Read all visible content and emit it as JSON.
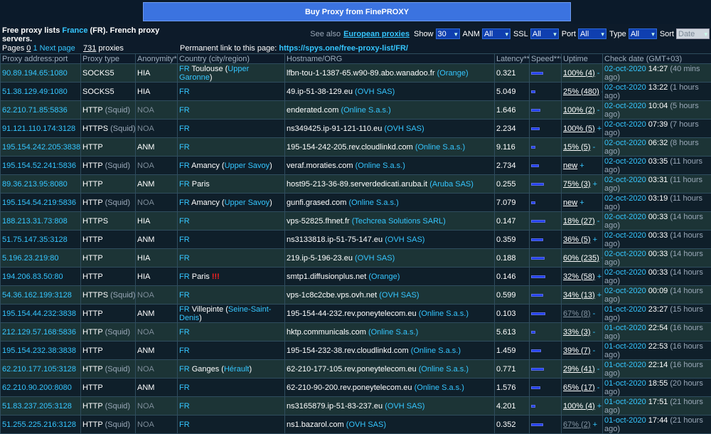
{
  "banner": {
    "label": "Buy Proxy from FinePROXY"
  },
  "header": {
    "free_prefix": "Free proxy lists ",
    "free_country": "France",
    "free_suffix": " (FR). French proxy servers.",
    "see_also": "See also",
    "european_link": "European proxies",
    "show_label": "Show",
    "show_value": "30",
    "anm_label": "ANM",
    "anm_value": "All",
    "ssl_label": "SSL",
    "ssl_value": "All",
    "port_label": "Port",
    "port_value": "All",
    "type_label": "Type",
    "type_value": "All",
    "sort_label": "Sort",
    "sort_value": "Date"
  },
  "pager": {
    "pages_label": "Pages",
    "page_current": "0",
    "page_1": "1",
    "next_label": "Next page",
    "count": "731",
    "count_suffix": " proxies",
    "perm_label": "Permanent link to this page: ",
    "perm_url": "https://spys.one/free-proxy-list/FR/"
  },
  "columns": [
    "Proxy address:port",
    "Proxy type",
    "Anonymity*",
    "Country (city/region)",
    "Hostname/ORG",
    "Latency**",
    "Speed***",
    "Uptime",
    "Check date (GMT+03)"
  ],
  "rows": [
    {
      "addr": "90.89.194.65:1080",
      "type": "SOCKS5",
      "squid": "",
      "anon": "HIA",
      "cc": "FR",
      "city": " Toulouse (",
      "region": "Upper Garonne",
      "rclose": ")",
      "host": "lfbn-tou-1-1387-65.w90-89.abo.wanadoo.fr",
      "org": "(Orange)",
      "lat": "0.321",
      "speed": 0.7,
      "up": "100% (4)",
      "upsuf": " -",
      "date": "02-oct-2020",
      "time": " 14:27",
      "ago": " (40 mins ago)",
      "excl": ""
    },
    {
      "addr": "51.38.129.49:1080",
      "type": "SOCKS5",
      "squid": "",
      "anon": "HIA",
      "cc": "FR",
      "city": "",
      "region": "",
      "rclose": "",
      "host": "49.ip-51-38-129.eu",
      "org": "(OVH SAS)",
      "lat": "5.049",
      "speed": 0.15,
      "up": "25% (480)",
      "upsuf": " -",
      "date": "02-oct-2020",
      "time": " 13:22",
      "ago": " (1 hours ago)",
      "excl": ""
    },
    {
      "addr": "62.210.71.85:5836",
      "type": "HTTP",
      "squid": " (Squid)",
      "anon": "NOA",
      "cc": "FR",
      "city": "",
      "region": "",
      "rclose": "",
      "host": "enderated.com",
      "org": "(Online S.a.s.)",
      "lat": "1.646",
      "speed": 0.55,
      "up": "100% (2)",
      "upsuf": " -",
      "date": "02-oct-2020",
      "time": " 10:04",
      "ago": " (5 hours ago)",
      "excl": ""
    },
    {
      "addr": "91.121.110.174:3128",
      "type": "HTTPS",
      "squid": " (Squid)",
      "anon": "NOA",
      "cc": "FR",
      "city": "",
      "region": "",
      "rclose": "",
      "host": "ns349425.ip-91-121-110.eu",
      "org": "(OVH SAS)",
      "lat": "2.234",
      "speed": 0.5,
      "up": "100% (5)",
      "upsuf": " +",
      "date": "02-oct-2020",
      "time": " 07:39",
      "ago": " (7 hours ago)",
      "excl": ""
    },
    {
      "addr": "195.154.242.205:3838",
      "type": "HTTP",
      "squid": "",
      "anon": "ANM",
      "cc": "FR",
      "city": "",
      "region": "",
      "rclose": "",
      "host": "195-154-242-205.rev.cloudlinkd.com",
      "org": "(Online S.a.s.)",
      "lat": "9.116",
      "speed": 0.1,
      "up": "15% (5)",
      "upsuf": " -",
      "date": "02-oct-2020",
      "time": " 06:32",
      "ago": " (8 hours ago)",
      "excl": ""
    },
    {
      "addr": "195.154.52.241:5836",
      "type": "HTTP",
      "squid": " (Squid)",
      "anon": "NOA",
      "cc": "FR",
      "city": " Amancy (",
      "region": "Upper Savoy",
      "rclose": ")",
      "host": "veraf.moraties.com",
      "org": "(Online S.a.s.)",
      "lat": "2.734",
      "speed": 0.45,
      "up": "new",
      "upsuf": " +",
      "date": "02-oct-2020",
      "time": " 03:35",
      "ago": " (11 hours ago)",
      "excl": ""
    },
    {
      "addr": "89.36.213.95:8080",
      "type": "HTTP",
      "squid": "",
      "anon": "ANM",
      "cc": "FR",
      "city": " Paris",
      "region": "",
      "rclose": "",
      "host": "host95-213-36-89.serverdedicati.aruba.it",
      "org": "(Aruba SAS)",
      "lat": "0.255",
      "speed": 0.75,
      "up": "75% (3)",
      "upsuf": " +",
      "date": "02-oct-2020",
      "time": " 03:31",
      "ago": " (11 hours ago)",
      "excl": ""
    },
    {
      "addr": "195.154.54.219:5836",
      "type": "HTTP",
      "squid": " (Squid)",
      "anon": "NOA",
      "cc": "FR",
      "city": " Amancy (",
      "region": "Upper Savoy",
      "rclose": ")",
      "host": "gunfi.grased.com",
      "org": "(Online S.a.s.)",
      "lat": "7.079",
      "speed": 0.15,
      "up": "new",
      "upsuf": " +",
      "date": "02-oct-2020",
      "time": " 03:19",
      "ago": " (11 hours ago)",
      "excl": ""
    },
    {
      "addr": "188.213.31.73:808",
      "type": "HTTPS",
      "squid": "",
      "anon": "HIA",
      "cc": "FR",
      "city": "",
      "region": "",
      "rclose": "",
      "host": "vps-52825.fhnet.fr",
      "org": "(Techcrea Solutions SARL)",
      "lat": "0.147",
      "speed": 0.85,
      "up": "18% (27)",
      "upsuf": " -",
      "date": "02-oct-2020",
      "time": " 00:33",
      "ago": " (14 hours ago)",
      "excl": ""
    },
    {
      "addr": "51.75.147.35:3128",
      "type": "HTTP",
      "squid": "",
      "anon": "ANM",
      "cc": "FR",
      "city": "",
      "region": "",
      "rclose": "",
      "host": "ns3133818.ip-51-75-147.eu",
      "org": "(OVH SAS)",
      "lat": "0.359",
      "speed": 0.7,
      "up": "36% (5)",
      "upsuf": " +",
      "date": "02-oct-2020",
      "time": " 00:33",
      "ago": " (14 hours ago)",
      "excl": ""
    },
    {
      "addr": "5.196.23.219:80",
      "type": "HTTP",
      "squid": "",
      "anon": "HIA",
      "cc": "FR",
      "city": "",
      "region": "",
      "rclose": "",
      "host": "219.ip-5-196-23.eu",
      "org": "(OVH SAS)",
      "lat": "0.188",
      "speed": 0.8,
      "up": "60% (235)",
      "upsuf": " +",
      "date": "02-oct-2020",
      "time": " 00:33",
      "ago": " (14 hours ago)",
      "excl": ""
    },
    {
      "addr": "194.206.83.50:80",
      "type": "HTTP",
      "squid": "",
      "anon": "HIA",
      "cc": "FR",
      "city": " Paris ",
      "region": "",
      "rclose": "",
      "host": "smtp1.diffusionplus.net",
      "org": "(Orange)",
      "lat": "0.146",
      "speed": 0.85,
      "up": "32% (58)",
      "upsuf": " +",
      "date": "02-oct-2020",
      "time": " 00:33",
      "ago": " (14 hours ago)",
      "excl": "!!!"
    },
    {
      "addr": "54.36.162.199:3128",
      "type": "HTTPS",
      "squid": " (Squid)",
      "anon": "NOA",
      "cc": "FR",
      "city": "",
      "region": "",
      "rclose": "",
      "host": "vps-1c8c2cbe.vps.ovh.net",
      "org": "(OVH SAS)",
      "lat": "0.599",
      "speed": 0.7,
      "up": "34% (13)",
      "upsuf": " +",
      "date": "02-oct-2020",
      "time": " 00:09",
      "ago": " (14 hours ago)",
      "excl": ""
    },
    {
      "addr": "195.154.44.232:3838",
      "type": "HTTP",
      "squid": "",
      "anon": "ANM",
      "cc": "FR",
      "city": " Villepinte (",
      "region": "Seine-Saint-Denis",
      "rclose": ")",
      "host": "195-154-44-232.rev.poneytelecom.eu",
      "org": "(Online S.a.s.)",
      "lat": "0.103",
      "speed": 0.85,
      "up": "67% (8)",
      "upsuf": " -",
      "date": "01-oct-2020",
      "time": " 23:27",
      "ago": " (15 hours ago)",
      "excl": ""
    },
    {
      "addr": "212.129.57.168:5836",
      "type": "HTTP",
      "squid": " (Squid)",
      "anon": "NOA",
      "cc": "FR",
      "city": "",
      "region": "",
      "rclose": "",
      "host": "hktp.communicals.com",
      "org": "(Online S.a.s.)",
      "lat": "5.613",
      "speed": 0.2,
      "up": "33% (3)",
      "upsuf": " -",
      "date": "01-oct-2020",
      "time": " 22:54",
      "ago": " (16 hours ago)",
      "excl": ""
    },
    {
      "addr": "195.154.232.38:3838",
      "type": "HTTP",
      "squid": "",
      "anon": "ANM",
      "cc": "FR",
      "city": "",
      "region": "",
      "rclose": "",
      "host": "195-154-232-38.rev.cloudlinkd.com",
      "org": "(Online S.a.s.)",
      "lat": "1.459",
      "speed": 0.6,
      "up": "39% (7)",
      "upsuf": " -",
      "date": "01-oct-2020",
      "time": " 22:53",
      "ago": " (16 hours ago)",
      "excl": ""
    },
    {
      "addr": "62.210.177.105:3128",
      "type": "HTTP",
      "squid": " (Squid)",
      "anon": "NOA",
      "cc": "FR",
      "city": " Ganges (",
      "region": "Hérault",
      "rclose": ")",
      "host": "62-210-177-105.rev.poneytelecom.eu",
      "org": "(Online S.a.s.)",
      "lat": "0.771",
      "speed": 0.75,
      "up": "29% (41)",
      "upsuf": " -",
      "date": "01-oct-2020",
      "time": " 22:14",
      "ago": " (16 hours ago)",
      "excl": ""
    },
    {
      "addr": "62.210.90.200:8080",
      "type": "HTTP",
      "squid": "",
      "anon": "ANM",
      "cc": "FR",
      "city": "",
      "region": "",
      "rclose": "",
      "host": "62-210-90-200.rev.poneytelecom.eu",
      "org": "(Online S.a.s.)",
      "lat": "1.576",
      "speed": 0.55,
      "up": "65% (17)",
      "upsuf": " -",
      "date": "01-oct-2020",
      "time": " 18:55",
      "ago": " (20 hours ago)",
      "excl": ""
    },
    {
      "addr": "51.83.237.205:3128",
      "type": "HTTP",
      "squid": " (Squid)",
      "anon": "NOA",
      "cc": "FR",
      "city": "",
      "region": "",
      "rclose": "",
      "host": "ns3165879.ip-51-83-237.eu",
      "org": "(OVH SAS)",
      "lat": "4.201",
      "speed": 0.2,
      "up": "100% (4)",
      "upsuf": " +",
      "date": "01-oct-2020",
      "time": " 17:51",
      "ago": " (21 hours ago)",
      "excl": ""
    },
    {
      "addr": "51.255.225.216:3128",
      "type": "HTTP",
      "squid": " (Squid)",
      "anon": "NOA",
      "cc": "FR",
      "city": "",
      "region": "",
      "rclose": "",
      "host": "ns1.bazarol.com",
      "org": "(OVH SAS)",
      "lat": "0.352",
      "speed": 0.7,
      "up": "67% (2)",
      "upsuf": " +",
      "date": "01-oct-2020",
      "time": " 17:44",
      "ago": " (21 hours ago)",
      "excl": ""
    }
  ],
  "grey_uptime_rows": [
    13,
    19
  ]
}
